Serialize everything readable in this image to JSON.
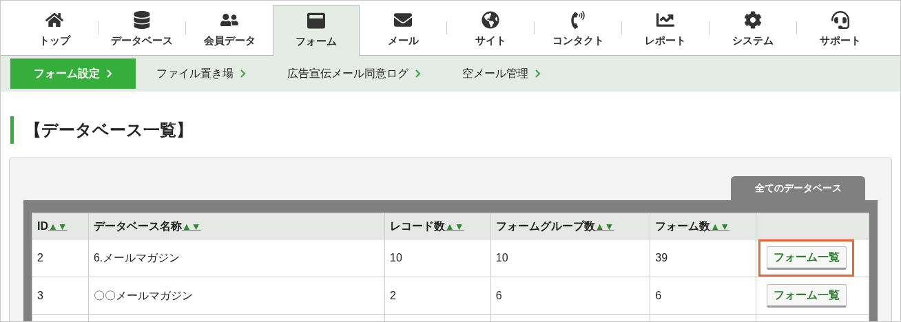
{
  "main_nav": [
    {
      "label": "トップ",
      "selected": false
    },
    {
      "label": "データベース",
      "selected": false
    },
    {
      "label": "会員データ",
      "selected": false
    },
    {
      "label": "フォーム",
      "selected": true
    },
    {
      "label": "メール",
      "selected": false
    },
    {
      "label": "サイト",
      "selected": false
    },
    {
      "label": "コンタクト",
      "selected": false
    },
    {
      "label": "レポート",
      "selected": false
    },
    {
      "label": "システム",
      "selected": false
    },
    {
      "label": "サポート",
      "selected": false
    }
  ],
  "sub_nav": [
    {
      "label": "フォーム設定",
      "selected": true
    },
    {
      "label": "ファイル置き場",
      "selected": false
    },
    {
      "label": "広告宣伝メール同意ログ",
      "selected": false
    },
    {
      "label": "空メール管理",
      "selected": false
    }
  ],
  "page_title": "【データベース一覧】",
  "panel_tab": "全てのデータベース",
  "table": {
    "columns": [
      {
        "label": "ID",
        "sort": "▲▼"
      },
      {
        "label": "データベース名称",
        "sort": "▲▼"
      },
      {
        "label": "レコード数",
        "sort": "▲▼"
      },
      {
        "label": "フォームグループ数",
        "sort": "▲▼"
      },
      {
        "label": "フォーム数",
        "sort": "▲▼"
      }
    ],
    "rows": [
      {
        "cells": [
          "2",
          "6.メールマガジン",
          "10",
          "10",
          "39"
        ],
        "action": "フォーム一覧",
        "highlighted": true
      },
      {
        "cells": [
          "3",
          "〇〇メールマガジン",
          "2",
          "6",
          "6"
        ],
        "action": "フォーム一覧",
        "highlighted": false
      }
    ]
  }
}
